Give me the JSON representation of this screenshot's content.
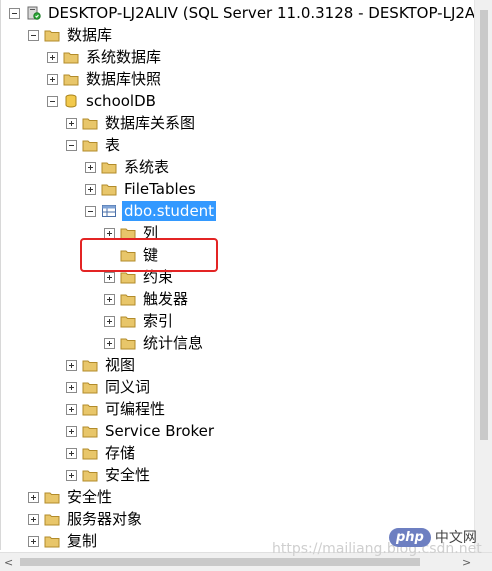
{
  "tree": {
    "nodes": [
      {
        "label": "DESKTOP-LJ2ALIV (SQL Server 11.0.3128 - DESKTOP-LJ2AL",
        "icon": "server-icon",
        "expander": "minus"
      },
      {
        "label": "数据库",
        "icon": "folder-icon",
        "expander": "minus"
      },
      {
        "label": "系统数据库",
        "icon": "folder-icon",
        "expander": "plus"
      },
      {
        "label": "数据库快照",
        "icon": "folder-icon",
        "expander": "plus"
      },
      {
        "label": "schoolDB",
        "icon": "database-icon",
        "expander": "minus"
      },
      {
        "label": "数据库关系图",
        "icon": "folder-icon",
        "expander": "plus"
      },
      {
        "label": "表",
        "icon": "folder-icon",
        "expander": "minus"
      },
      {
        "label": "系统表",
        "icon": "folder-icon",
        "expander": "plus"
      },
      {
        "label": "FileTables",
        "icon": "folder-icon",
        "expander": "plus"
      },
      {
        "label": "dbo.student",
        "icon": "table-icon",
        "expander": "minus",
        "selected": true
      },
      {
        "label": "列",
        "icon": "folder-icon",
        "expander": "plus"
      },
      {
        "label": "键",
        "icon": "folder-icon",
        "expander": "none"
      },
      {
        "label": "约束",
        "icon": "folder-icon",
        "expander": "plus"
      },
      {
        "label": "触发器",
        "icon": "folder-icon",
        "expander": "plus"
      },
      {
        "label": "索引",
        "icon": "folder-icon",
        "expander": "plus"
      },
      {
        "label": "统计信息",
        "icon": "folder-icon",
        "expander": "plus"
      },
      {
        "label": "视图",
        "icon": "folder-icon",
        "expander": "plus"
      },
      {
        "label": "同义词",
        "icon": "folder-icon",
        "expander": "plus"
      },
      {
        "label": "可编程性",
        "icon": "folder-icon",
        "expander": "plus"
      },
      {
        "label": "Service Broker",
        "icon": "folder-icon",
        "expander": "plus"
      },
      {
        "label": "存储",
        "icon": "folder-icon",
        "expander": "plus"
      },
      {
        "label": "安全性",
        "icon": "folder-icon",
        "expander": "plus"
      },
      {
        "label": "安全性",
        "icon": "folder-icon",
        "expander": "plus"
      },
      {
        "label": "服务器对象",
        "icon": "folder-icon",
        "expander": "plus"
      },
      {
        "label": "复制",
        "icon": "folder-icon",
        "expander": "plus"
      }
    ]
  },
  "colors": {
    "selection": "#3399ff",
    "highlight_box": "#e32424",
    "folder": "#e8c66a"
  },
  "scrollbar": {
    "left_arrow": "<",
    "right_arrow": ">"
  },
  "watermark": "https://mailiang.blog.csdn.net",
  "badge": {
    "logo": "php",
    "text": "中文网"
  }
}
